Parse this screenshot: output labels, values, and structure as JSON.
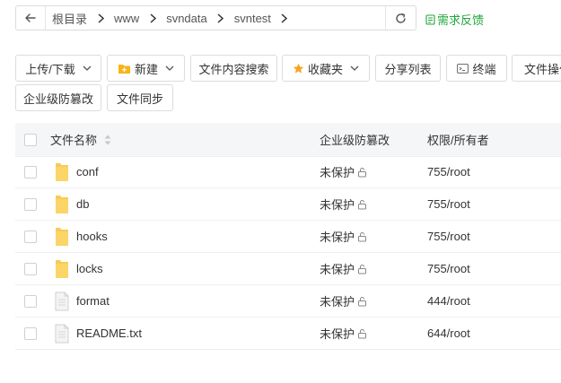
{
  "address_bar": {
    "crumbs": [
      "根目录",
      "www",
      "svndata",
      "svntest"
    ]
  },
  "feedback_label": "需求反馈",
  "toolbar": {
    "upload_download": "上传/下载",
    "new": "新建",
    "content_search": "文件内容搜索",
    "favorites": "收藏夹",
    "share_list": "分享列表",
    "terminal": "终端",
    "file_ops": "文件操作",
    "tamper_protect": "企业级防篡改",
    "file_sync": "文件同步"
  },
  "table": {
    "headers": {
      "name": "文件名称",
      "tamper": "企业级防篡改",
      "perm": "权限/所有者"
    },
    "rows": [
      {
        "type": "folder",
        "name": "conf",
        "tamper": "未保护",
        "perm": "755/root"
      },
      {
        "type": "folder",
        "name": "db",
        "tamper": "未保护",
        "perm": "755/root"
      },
      {
        "type": "folder",
        "name": "hooks",
        "tamper": "未保护",
        "perm": "755/root"
      },
      {
        "type": "folder",
        "name": "locks",
        "tamper": "未保护",
        "perm": "755/root"
      },
      {
        "type": "file",
        "name": "format",
        "tamper": "未保护",
        "perm": "444/root"
      },
      {
        "type": "file",
        "name": "README.txt",
        "tamper": "未保护",
        "perm": "644/root"
      }
    ]
  },
  "colors": {
    "accent": "#20a53a",
    "folder": "#f8ca56",
    "header_bg": "#f5f6f7"
  },
  "icons": [
    "back-arrow-icon",
    "chevron-right-icon",
    "refresh-icon",
    "feedback-icon",
    "chevron-down-icon",
    "new-folder-icon",
    "star-icon",
    "terminal-icon",
    "sort-icon",
    "folder-icon",
    "file-icon",
    "lock-icon"
  ]
}
